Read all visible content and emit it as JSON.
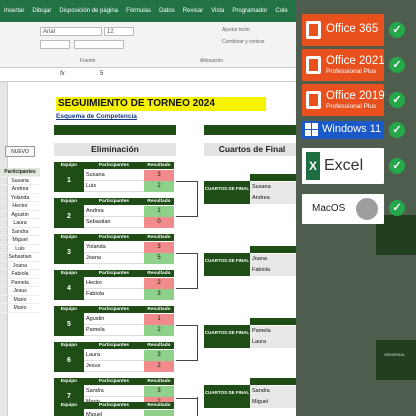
{
  "ribbon": {
    "tabs": [
      "Insertar",
      "Dibujar",
      "Disposición de página",
      "Fórmulas",
      "Datos",
      "Revisar",
      "Vista",
      "Programador",
      "Cole"
    ],
    "font_name": "Arial",
    "font_size": "12",
    "wrap_label": "Ajustar texto",
    "merge_label": "Combinar y centrar",
    "group_font": "Fuente",
    "group_align": "Alineación"
  },
  "formula_bar": {
    "cell_value": "5"
  },
  "sheet": {
    "title": "SEGUIMIENTO DE TORNEO 2024",
    "subtitle": "Esquema de Competencia",
    "nuevo_button": "NUEVO",
    "participants_header": "Participantes",
    "participants": [
      "Susana",
      "Andrea",
      "Yolanda",
      "Hector",
      "Agustin",
      "Laura",
      "Sandra",
      "Miguel",
      "Luis",
      "Sebastian",
      "Joana",
      "Fabiola",
      "Pamela",
      "Jesus",
      "Mario",
      "Mario"
    ],
    "elimination_title": "Eliminación",
    "quarters_title": "Cuartos de Final",
    "match_headers": {
      "team": "Equipo",
      "participants": "Participantes",
      "result": "Resultado"
    },
    "matches": [
      {
        "num": "1",
        "p1": "Susana",
        "r1": "3",
        "c1": "red",
        "p2": "Luis",
        "r2": "2",
        "c2": "green"
      },
      {
        "num": "2",
        "p1": "Andrea",
        "r1": "1",
        "c1": "green",
        "p2": "Sebastian",
        "r2": "0",
        "c2": "red"
      },
      {
        "num": "3",
        "p1": "Yolanda",
        "r1": "3",
        "c1": "red",
        "p2": "Joana",
        "r2": "5",
        "c2": "green"
      },
      {
        "num": "4",
        "p1": "Hector",
        "r1": "2",
        "c1": "red",
        "p2": "Fabiola",
        "r2": "3",
        "c2": "green"
      },
      {
        "num": "5",
        "p1": "Agustin",
        "r1": "1",
        "c1": "red",
        "p2": "Pamela",
        "r2": "2",
        "c2": "green"
      },
      {
        "num": "6",
        "p1": "Laura",
        "r1": "3",
        "c1": "green",
        "p2": "Jesus",
        "r2": "2",
        "c2": "red"
      },
      {
        "num": "7",
        "p1": "Sandra",
        "r1": "3",
        "c1": "green",
        "p2": "Mario",
        "r2": "2",
        "c2": "red"
      },
      {
        "num": "8",
        "p1": "Miguel",
        "r1": "",
        "c1": "green",
        "p2": "",
        "r2": "",
        "c2": "red"
      }
    ],
    "quarter_label": "CUARTOS DE FINAL",
    "quarters": [
      {
        "p1": "Susana",
        "p2": "Andrea"
      },
      {
        "p1": "Joana",
        "p2": "Fabiola"
      },
      {
        "p1": "Pamela",
        "p2": "Laura"
      },
      {
        "p1": "Sandra",
        "p2": "Miguel"
      }
    ],
    "semi_label": "SEMIFINAL"
  },
  "badges": {
    "office365": {
      "title": "Office 365",
      "subtitle": ""
    },
    "office2021": {
      "title": "Office 2021",
      "subtitle": "Professional Plus"
    },
    "office2019": {
      "title": "Office 2019",
      "subtitle": "Professional Plus"
    },
    "windows": "Windows 11",
    "excel": "Excel",
    "macos": "MacOS",
    "check": "✓"
  },
  "colors": {
    "excel_green": "#217346",
    "dark_green": "#1e4d16",
    "office_orange": "#e8501e",
    "windows_blue": "#1b58c8",
    "check_green": "#24a84a",
    "title_yellow": "#f7f200",
    "loss_red": "#f28b8b",
    "win_green": "#8fd08a"
  }
}
